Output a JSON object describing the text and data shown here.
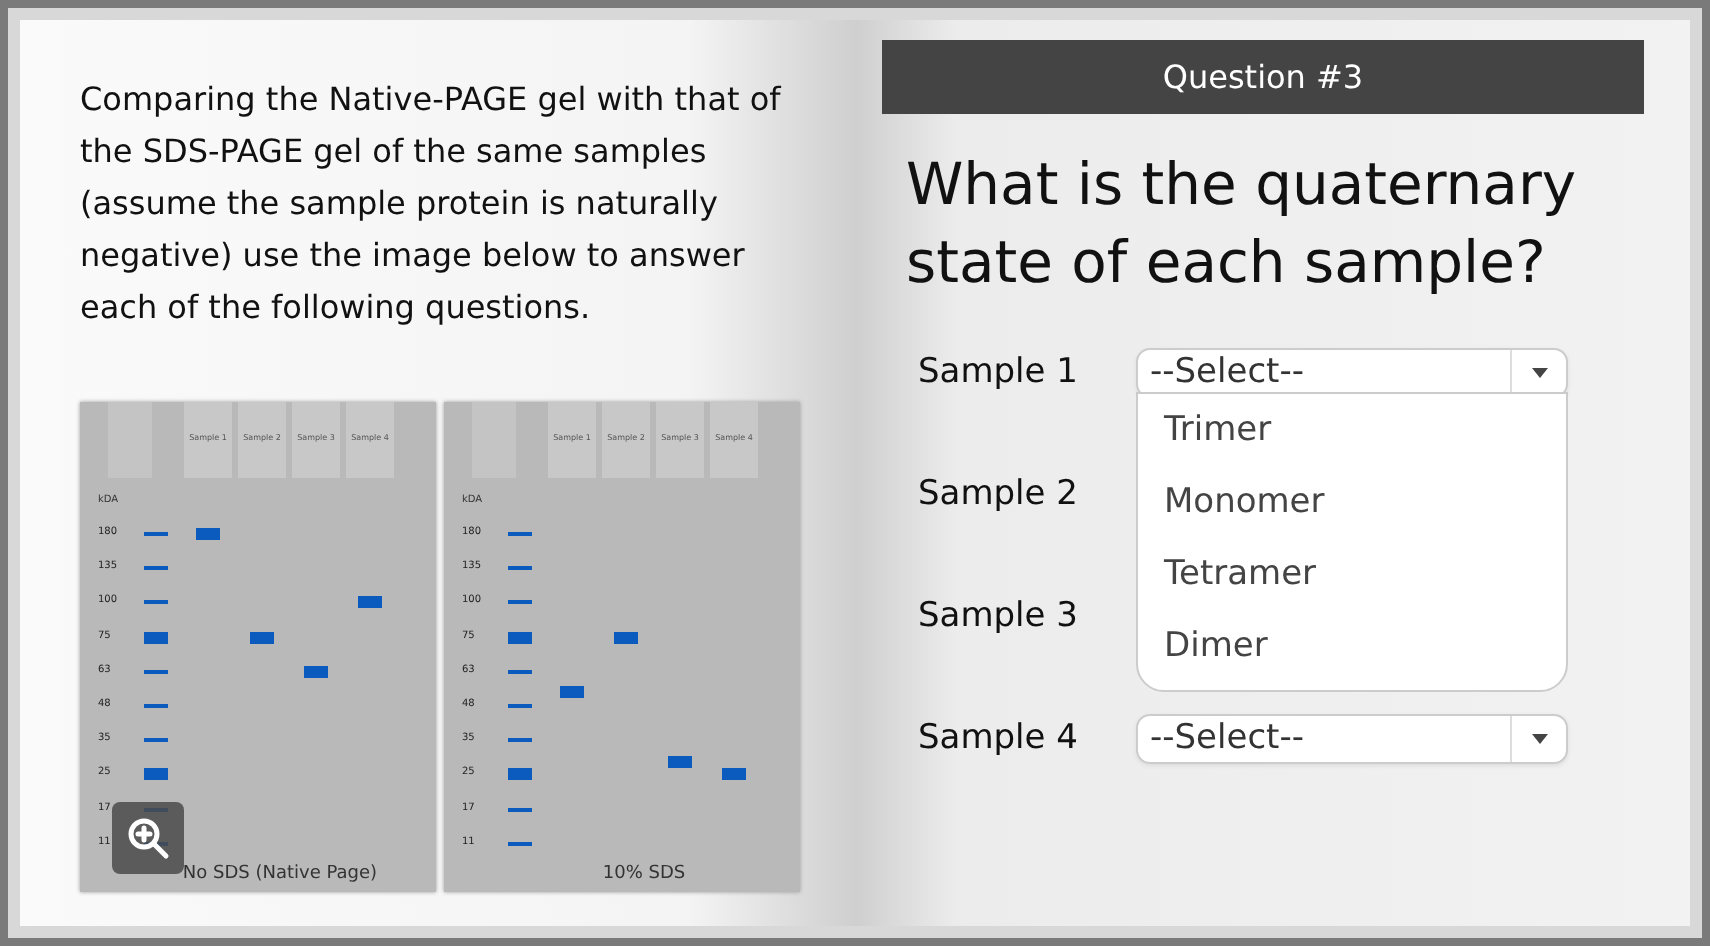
{
  "left_page": {
    "instructions": "Comparing the Native-PAGE gel with that of the SDS-PAGE gel of the same samples (assume the sample protein is naturally negative) use the image below to answer each of the following questions.",
    "gels": [
      {
        "caption": "No SDS (Native Page)",
        "unit": "kDA",
        "lanes": [
          "Sample 1",
          "Sample 2",
          "Sample 3",
          "Sample 4"
        ],
        "zoom_button": true,
        "markers": [
          {
            "label": "180",
            "thick": false
          },
          {
            "label": "135",
            "thick": false
          },
          {
            "label": "100",
            "thick": false
          },
          {
            "label": "75",
            "thick": true
          },
          {
            "label": "63",
            "thick": false
          },
          {
            "label": "48",
            "thick": false
          },
          {
            "label": "35",
            "thick": false
          },
          {
            "label": "25",
            "thick": true
          },
          {
            "label": "17",
            "thick": false
          },
          {
            "label": "11",
            "thick": false
          }
        ]
      },
      {
        "caption": "10% SDS",
        "unit": "kDA",
        "lanes": [
          "Sample 1",
          "Sample 2",
          "Sample 3",
          "Sample 4"
        ],
        "zoom_button": false,
        "markers": [
          {
            "label": "180",
            "thick": false
          },
          {
            "label": "135",
            "thick": false
          },
          {
            "label": "100",
            "thick": false
          },
          {
            "label": "75",
            "thick": true
          },
          {
            "label": "63",
            "thick": false
          },
          {
            "label": "48",
            "thick": false
          },
          {
            "label": "35",
            "thick": false
          },
          {
            "label": "25",
            "thick": true
          },
          {
            "label": "17",
            "thick": false
          },
          {
            "label": "11",
            "thick": false
          }
        ]
      }
    ]
  },
  "right_page": {
    "header": "Question #3",
    "question": "What is the quaternary state of each sample?",
    "samples": [
      {
        "label": "Sample 1",
        "value": "--Select--",
        "open": true,
        "options": [
          "Trimer",
          "Monomer",
          "Tetramer",
          "Dimer"
        ]
      },
      {
        "label": "Sample 2",
        "open": false
      },
      {
        "label": "Sample 3",
        "open": false
      },
      {
        "label": "Sample 4",
        "value": "--Select--",
        "open": false
      }
    ]
  }
}
